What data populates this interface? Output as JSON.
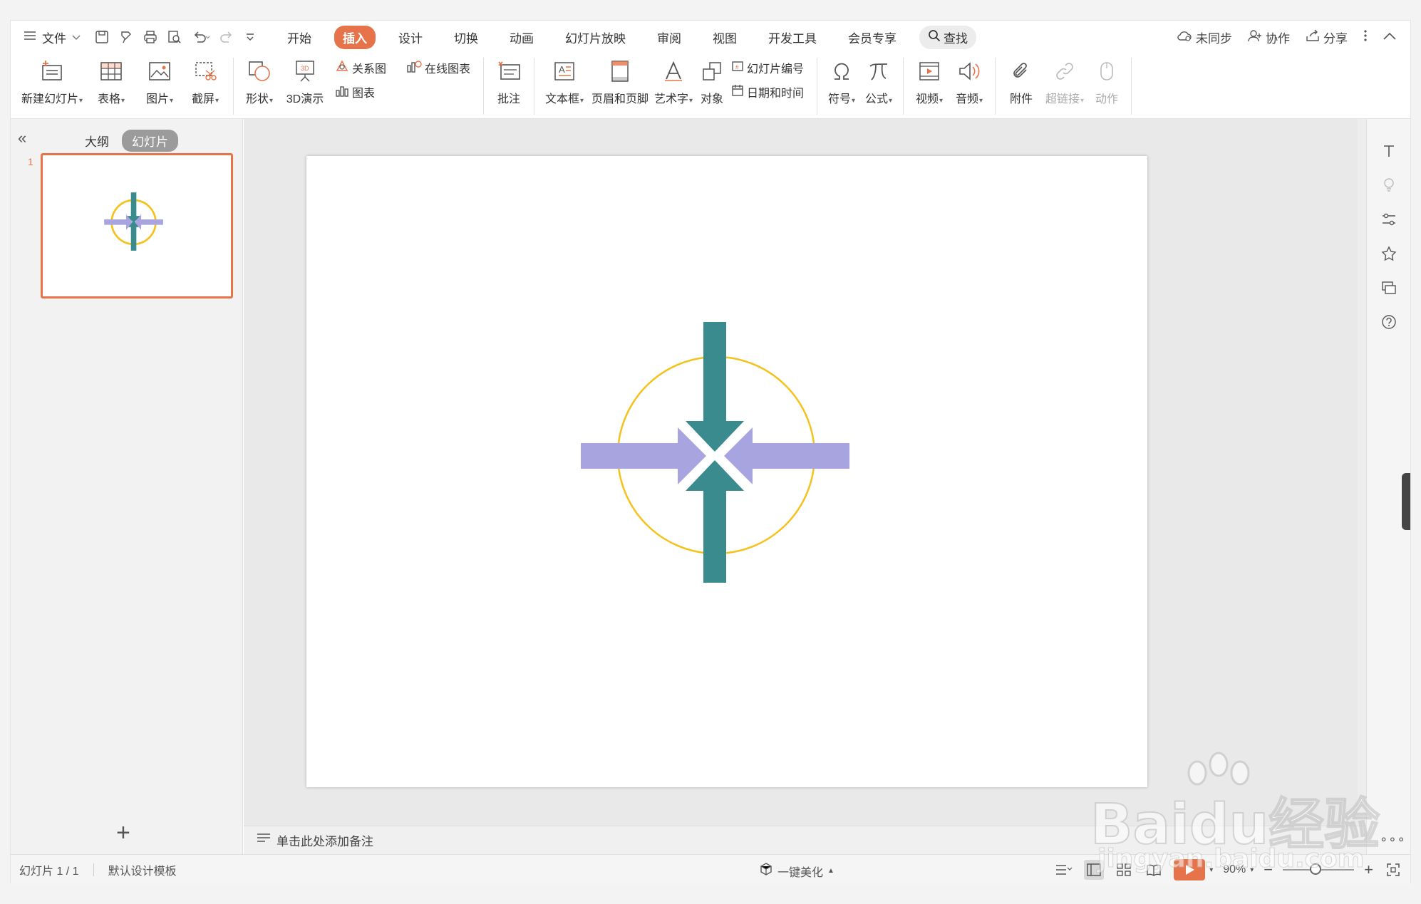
{
  "menu": {
    "file_label": "文件",
    "tabs": [
      {
        "label": "开始",
        "active": false
      },
      {
        "label": "插入",
        "active": true
      },
      {
        "label": "设计",
        "active": false
      },
      {
        "label": "切换",
        "active": false
      },
      {
        "label": "动画",
        "active": false
      },
      {
        "label": "幻灯片放映",
        "active": false
      },
      {
        "label": "审阅",
        "active": false
      },
      {
        "label": "视图",
        "active": false
      },
      {
        "label": "开发工具",
        "active": false
      },
      {
        "label": "会员专享",
        "active": false
      }
    ],
    "search_label": "查找",
    "right": {
      "sync": "未同步",
      "collab": "协作",
      "share": "分享"
    }
  },
  "ribbon": {
    "new_slide": "新建幻灯片",
    "table": "表格",
    "picture": "图片",
    "screenshot": "截屏",
    "shape": "形状",
    "demo3d": "3D演示",
    "relation": "关系图",
    "online_chart": "在线图表",
    "chart": "图表",
    "comment": "批注",
    "textbox": "文本框",
    "header_footer": "页眉和页脚",
    "wordart": "艺术字",
    "object": "对象",
    "slide_number": "幻灯片编号",
    "datetime": "日期和时间",
    "symbol": "符号",
    "formula": "公式",
    "video": "视频",
    "audio": "音频",
    "attachment": "附件",
    "hyperlink": "超链接",
    "action": "动作"
  },
  "left_panel": {
    "tab_outline": "大纲",
    "tab_slides": "幻灯片",
    "slide_number": "1"
  },
  "notes_placeholder": "单击此处添加备注",
  "status": {
    "slide_info": "幻灯片 1 / 1",
    "template": "默认设计模板",
    "beautify": "一键美化",
    "zoom": "90%"
  },
  "colors": {
    "accent": "#e7734a",
    "teal_arrow": "#3a8b8e",
    "lavender_arrow": "#a8a4e0",
    "circle": "#f5c21b"
  },
  "watermark": {
    "line1": "Baidu经验",
    "line2": "jingyan.baidu.com"
  }
}
